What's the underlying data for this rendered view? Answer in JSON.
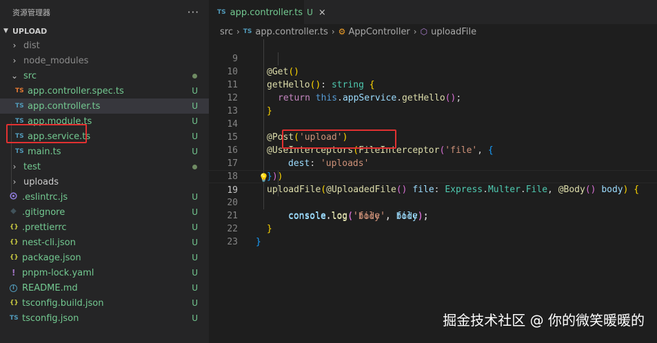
{
  "sidebar": {
    "title": "资源管理器",
    "more_label": "···",
    "section_title": "UPLOAD",
    "items": [
      {
        "label": "dist",
        "type": "folder"
      },
      {
        "label": "node_modules",
        "type": "folder"
      },
      {
        "label": "src",
        "type": "folder-open"
      },
      {
        "label": "app.controller.spec.ts",
        "icon": "TS",
        "badge": "U"
      },
      {
        "label": "app.controller.ts",
        "icon": "TS",
        "badge": "U"
      },
      {
        "label": "app.module.ts",
        "icon": "TS",
        "badge": "U"
      },
      {
        "label": "app.service.ts",
        "icon": "TS",
        "badge": "U"
      },
      {
        "label": "main.ts",
        "icon": "TS",
        "badge": "U"
      },
      {
        "label": "test",
        "type": "folder"
      },
      {
        "label": "uploads",
        "type": "folder"
      },
      {
        "label": ".eslintrc.js",
        "badge": "U"
      },
      {
        "label": ".gitignore",
        "badge": "U"
      },
      {
        "label": ".prettierrc",
        "icon": "{}",
        "badge": "U"
      },
      {
        "label": "nest-cli.json",
        "icon": "{}",
        "badge": "U"
      },
      {
        "label": "package.json",
        "icon": "{}",
        "badge": "U"
      },
      {
        "label": "pnpm-lock.yaml",
        "icon": "!",
        "badge": "U"
      },
      {
        "label": "README.md",
        "icon": "i",
        "badge": "U"
      },
      {
        "label": "tsconfig.build.json",
        "icon": "{}",
        "badge": "U"
      },
      {
        "label": "tsconfig.json",
        "icon": "TS",
        "badge": "U"
      }
    ]
  },
  "editor": {
    "tab": {
      "icon": "TS",
      "label": "app.controller.ts",
      "status": "U",
      "close": "×"
    },
    "breadcrumb": {
      "src": "src",
      "ts_icon": "TS",
      "file": "app.controller.ts",
      "class": "AppController",
      "method": "uploadFile"
    },
    "line_numbers": [
      "9",
      "10",
      "11",
      "12",
      "13",
      "14",
      "15",
      "16",
      "17",
      "18",
      "19",
      "20",
      "21",
      "22",
      "23"
    ],
    "code": {
      "l9": {
        "at": "@",
        "dec": "Get",
        "paren": "()"
      },
      "l10": {
        "fn": "getHello",
        "paren": "()",
        "colon": ": ",
        "type": "string",
        "brace": " {"
      },
      "l11": {
        "kw": "return",
        "this": " this",
        "dot1": ".",
        "prop": "appService",
        "dot2": ".",
        "fn": "getHello",
        "paren": "()",
        "semi": ";"
      },
      "l12": {
        "brace": "}"
      },
      "l14": {
        "at": "@",
        "dec": "Post",
        "open": "(",
        "str": "'upload'",
        "close": ")"
      },
      "l15": {
        "at": "@",
        "dec": "UseInterceptors",
        "open": "(",
        "fn": "FileInterceptor",
        "open2": "(",
        "str": "'file'",
        "comma": ", ",
        "brace": "{"
      },
      "l16": {
        "key": "dest",
        "colon": ": ",
        "str": "'uploads'"
      },
      "l17": {
        "brace": "}",
        "close2": ")",
        "close1": ")"
      },
      "l18": {
        "fn": "uploadFile",
        "open": "(",
        "at": "@",
        "dec": "UploadedFile",
        "paren": "()",
        "param": " file",
        "colon": ": ",
        "ns": "Express",
        "dot1": ".",
        "ns2": "Multer",
        "dot2": ".",
        "type": "File",
        "comma": ", ",
        "at2": "@",
        "dec2": "Body",
        "paren2": "()",
        "param2": " body",
        "close": ")",
        "brace": " {"
      },
      "l19": {
        "obj": "console",
        "dot": ".",
        "fn": "log",
        "open": "(",
        "str": "'body'",
        "comma": ", ",
        "arg": "body",
        "close": ")",
        "semi": ";"
      },
      "l20": {
        "obj": "console",
        "dot": ".",
        "fn": "log",
        "open": "(",
        "str": "'file'",
        "comma": ", ",
        "arg": "file",
        "close": ")",
        "semi": ";"
      },
      "l21": {
        "brace": "}"
      },
      "l22": {
        "brace": "}"
      }
    }
  },
  "watermark": "掘金技术社区 @ 你的微笑暖暖的",
  "colors": {
    "untracked": "#73c991",
    "highlight_box": "#e23131",
    "ts_icon": "#519aba"
  }
}
